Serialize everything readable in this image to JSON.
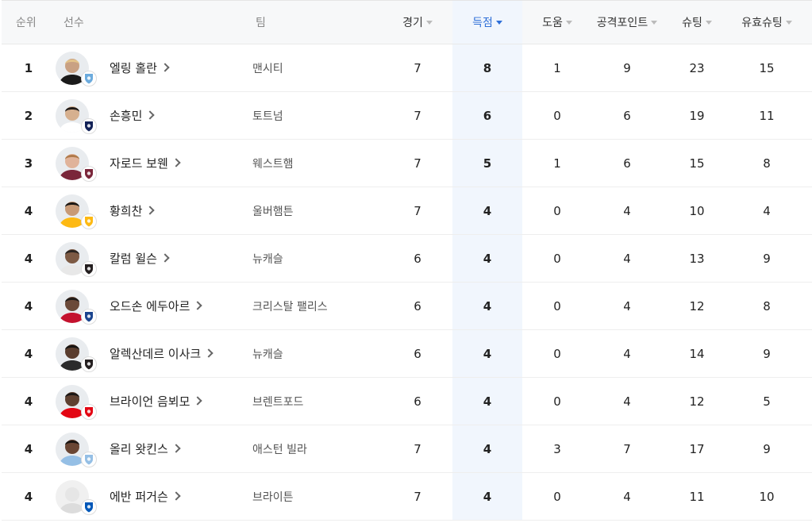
{
  "header": {
    "rank": "순위",
    "player": "선수",
    "team": "팀",
    "games": "경기",
    "goals": "득점",
    "assists": "도움",
    "points": "공격포인트",
    "shots": "슈팅",
    "shots_on_target": "유효슈팅"
  },
  "rows": [
    {
      "rank": "1",
      "name": "엘링 홀란",
      "team": "맨시티",
      "games": "7",
      "goals": "8",
      "assists": "1",
      "points": "9",
      "shots": "23",
      "sot": "15",
      "skin": "#c9a183",
      "hair": "#e3c38a",
      "shirt": "#1b1b1b",
      "club_color": "#6cabdd",
      "club_icon": "man-city-crest-icon"
    },
    {
      "rank": "2",
      "name": "손흥민",
      "team": "토트넘",
      "games": "7",
      "goals": "6",
      "assists": "0",
      "points": "6",
      "shots": "19",
      "sot": "11",
      "skin": "#d6b08f",
      "hair": "#1e1a18",
      "shirt": "#ffffff",
      "club_color": "#132257",
      "club_icon": "tottenham-crest-icon"
    },
    {
      "rank": "3",
      "name": "자로드 보웬",
      "team": "웨스트햄",
      "games": "7",
      "goals": "5",
      "assists": "1",
      "points": "6",
      "shots": "15",
      "sot": "8",
      "skin": "#e0b39a",
      "hair": "#b07a4a",
      "shirt": "#7a263a",
      "club_color": "#7a263a",
      "club_icon": "west-ham-crest-icon"
    },
    {
      "rank": "4",
      "name": "황희찬",
      "team": "울버햄튼",
      "games": "7",
      "goals": "4",
      "assists": "0",
      "points": "4",
      "shots": "10",
      "sot": "4",
      "skin": "#c89a76",
      "hair": "#1a1714",
      "shirt": "#fdb913",
      "club_color": "#fdb913",
      "club_icon": "wolves-crest-icon"
    },
    {
      "rank": "4",
      "name": "칼럼 윌슨",
      "team": "뉴캐슬",
      "games": "6",
      "goals": "4",
      "assists": "0",
      "points": "4",
      "shots": "13",
      "sot": "9",
      "skin": "#7d5a44",
      "hair": "#2a2420",
      "shirt": "#e8e8e8",
      "club_color": "#241f20",
      "club_icon": "newcastle-crest-icon"
    },
    {
      "rank": "4",
      "name": "오드손 에두아르",
      "team": "크리스탈 팰리스",
      "games": "6",
      "goals": "4",
      "assists": "0",
      "points": "4",
      "shots": "12",
      "sot": "8",
      "skin": "#6b4a39",
      "hair": "#1f1a17",
      "shirt": "#c4122e",
      "club_color": "#1b458f",
      "club_icon": "crystal-palace-crest-icon"
    },
    {
      "rank": "4",
      "name": "알렉산데르 이사크",
      "team": "뉴캐슬",
      "games": "6",
      "goals": "4",
      "assists": "0",
      "points": "4",
      "shots": "14",
      "sot": "9",
      "skin": "#5a3d2e",
      "hair": "#161311",
      "shirt": "#2b2b2b",
      "club_color": "#241f20",
      "club_icon": "newcastle-crest-icon"
    },
    {
      "rank": "4",
      "name": "브라이언 음뵈모",
      "team": "브렌트포드",
      "games": "6",
      "goals": "4",
      "assists": "0",
      "points": "4",
      "shots": "12",
      "sot": "5",
      "skin": "#5e4030",
      "hair": "#1b1715",
      "shirt": "#e30613",
      "club_color": "#e30613",
      "club_icon": "brentford-crest-icon"
    },
    {
      "rank": "4",
      "name": "올리 왓킨스",
      "team": "애스턴 빌라",
      "games": "7",
      "goals": "4",
      "assists": "3",
      "points": "7",
      "shots": "17",
      "sot": "9",
      "skin": "#6a4634",
      "hair": "#1a1512",
      "shirt": "#95bfe5",
      "club_color": "#95bfe5",
      "club_icon": "aston-villa-crest-icon"
    },
    {
      "rank": "4",
      "name": "에반 퍼거슨",
      "team": "브라이튼",
      "games": "7",
      "goals": "4",
      "assists": "0",
      "points": "4",
      "shots": "11",
      "sot": "10",
      "skin": "#e6e6e6",
      "hair": "#d0d0d0",
      "shirt": "#dcdcdc",
      "club_color": "#0057b8",
      "club_icon": "brighton-crest-icon"
    }
  ]
}
